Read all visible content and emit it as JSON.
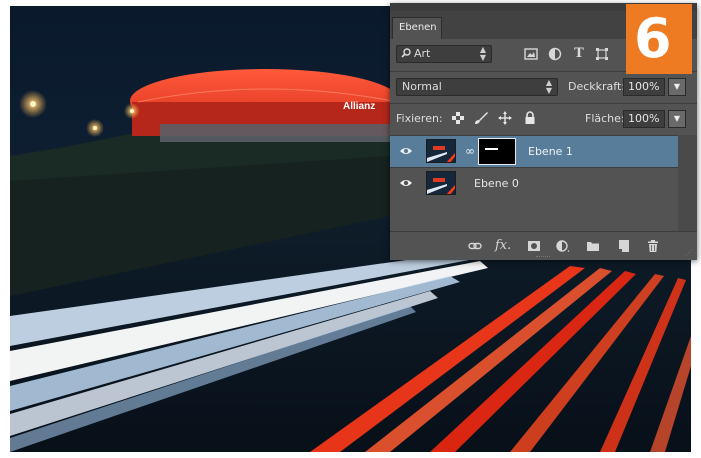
{
  "photo": {
    "stadium_sign": "Allianz"
  },
  "badge": {
    "step": "6",
    "color": "#ee7a21"
  },
  "layers_panel": {
    "tab_label": "Ebenen",
    "filter": {
      "value": "Art",
      "icons": [
        "image-filter-icon",
        "adjustment-filter-icon",
        "type-filter-icon",
        "shape-filter-icon"
      ]
    },
    "blend_mode": "Normal",
    "opacity_label": "Deckkraft:",
    "opacity_value": "100%",
    "lock_label": "Fixieren:",
    "lock_icons": [
      "lock-transparent-pixels-icon",
      "lock-image-pixels-icon",
      "lock-position-icon",
      "lock-all-icon"
    ],
    "fill_label": "Fläche:",
    "fill_value": "100%",
    "layers": [
      {
        "name": "Ebene 1",
        "selected": true,
        "has_mask": true
      },
      {
        "name": "Ebene 0",
        "selected": false,
        "has_mask": false
      }
    ],
    "bottom_icons": [
      "link-layers-icon",
      "layer-style-fx-icon",
      "add-mask-icon",
      "adjustment-layer-icon",
      "new-group-icon",
      "new-layer-icon",
      "delete-layer-icon"
    ],
    "selection_color": "#587d9b"
  }
}
